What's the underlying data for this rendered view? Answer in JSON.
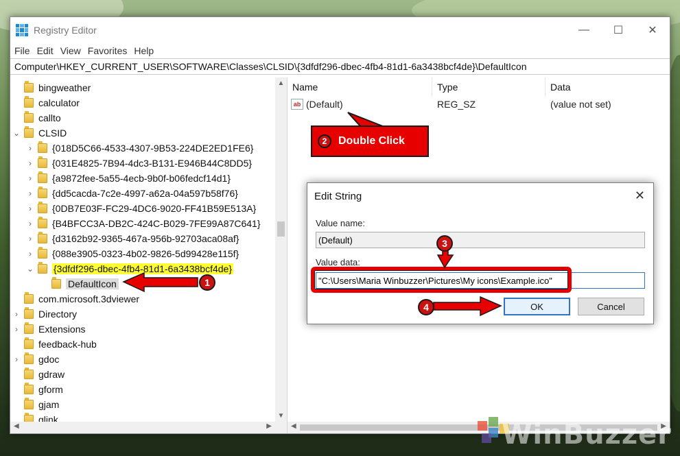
{
  "window": {
    "title": "Registry Editor",
    "controls": {
      "minimize": "—",
      "maximize": "☐",
      "close": "✕"
    }
  },
  "menu": [
    "File",
    "Edit",
    "View",
    "Favorites",
    "Help"
  ],
  "address": "Computer\\HKEY_CURRENT_USER\\SOFTWARE\\Classes\\CLSID\\{3dfdf296-dbec-4fb4-81d1-6a3438bcf4de}\\DefaultIcon",
  "tree": [
    {
      "label": "bingweather",
      "level": 0,
      "expander": ""
    },
    {
      "label": "calculator",
      "level": 0,
      "expander": ""
    },
    {
      "label": "callto",
      "level": 0,
      "expander": ""
    },
    {
      "label": "CLSID",
      "level": 0,
      "expander": "⌄"
    },
    {
      "label": "{018D5C66-4533-4307-9B53-224DE2ED1FE6}",
      "level": 1,
      "expander": "›"
    },
    {
      "label": "{031E4825-7B94-4dc3-B131-E946B44C8DD5}",
      "level": 1,
      "expander": "›"
    },
    {
      "label": "{a9872fee-5a55-4ecb-9b0f-b06fedcf14d1}",
      "level": 1,
      "expander": "›"
    },
    {
      "label": "{dd5cacda-7c2e-4997-a62a-04a597b58f76}",
      "level": 1,
      "expander": "›"
    },
    {
      "label": "{0DB7E03F-FC29-4DC6-9020-FF41B59E513A}",
      "level": 1,
      "expander": "›"
    },
    {
      "label": "{B4BFCC3A-DB2C-424C-B029-7FE99A87C641}",
      "level": 1,
      "expander": "›"
    },
    {
      "label": "{d3162b92-9365-467a-956b-92703aca08af}",
      "level": 1,
      "expander": "›"
    },
    {
      "label": "{088e3905-0323-4b02-9826-5d99428e115f}",
      "level": 1,
      "expander": "›"
    },
    {
      "label": "{3dfdf296-dbec-4fb4-81d1-6a3438bcf4de}",
      "level": 1,
      "expander": "⌄",
      "highlight": "yellow"
    },
    {
      "label": "DefaultIcon",
      "level": 2,
      "expander": "",
      "highlight": "selected"
    },
    {
      "label": "com.microsoft.3dviewer",
      "level": 0,
      "expander": ""
    },
    {
      "label": "Directory",
      "level": 0,
      "expander": "›"
    },
    {
      "label": "Extensions",
      "level": 0,
      "expander": "›"
    },
    {
      "label": "feedback-hub",
      "level": 0,
      "expander": ""
    },
    {
      "label": "gdoc",
      "level": 0,
      "expander": "›"
    },
    {
      "label": "gdraw",
      "level": 0,
      "expander": ""
    },
    {
      "label": "gform",
      "level": 0,
      "expander": ""
    },
    {
      "label": "gjam",
      "level": 0,
      "expander": ""
    },
    {
      "label": "glink",
      "level": 0,
      "expander": ""
    }
  ],
  "list": {
    "columns": [
      "Name",
      "Type",
      "Data"
    ],
    "rows": [
      {
        "icon": "ab-string-icon",
        "icon_text": "ab",
        "name": "(Default)",
        "type": "REG_SZ",
        "data": "(value not set)"
      }
    ]
  },
  "dialog": {
    "title": "Edit String",
    "close": "✕",
    "value_name_label": "Value name:",
    "value_name": "(Default)",
    "value_data_label": "Value data:",
    "value_data": "\"C:\\Users\\Maria Winbuzzer\\Pictures\\My icons\\Example.ico\"",
    "ok": "OK",
    "cancel": "Cancel"
  },
  "annotations": {
    "step1": "1",
    "step2": "2",
    "step2_text": "Double Click",
    "step3": "3",
    "step4": "4",
    "accent": "#e60000"
  },
  "watermark": "WinBuzzer"
}
